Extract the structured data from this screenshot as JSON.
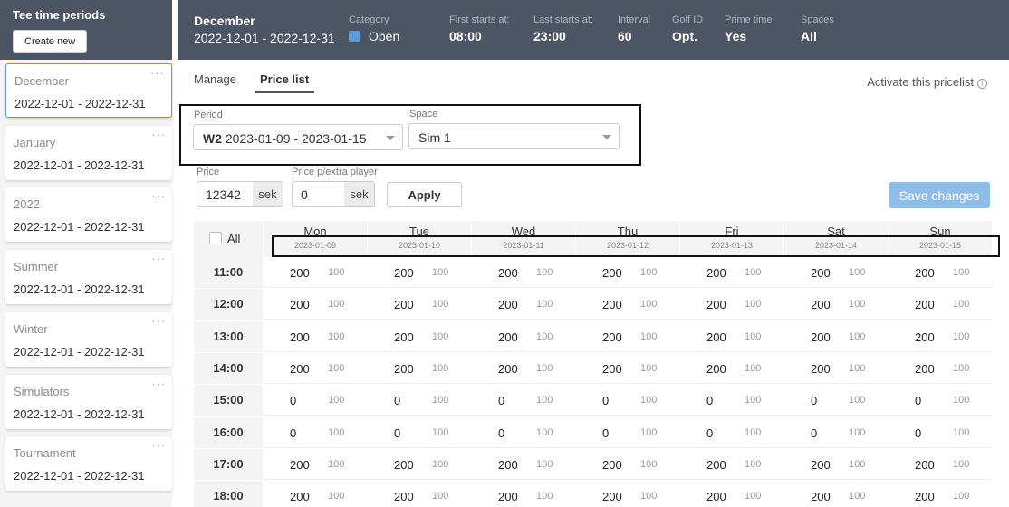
{
  "sidebar": {
    "title": "Tee time periods",
    "create_label": "Create new",
    "items": [
      {
        "name": "December",
        "range": "2022-12-01 - 2022-12-31"
      },
      {
        "name": "January",
        "range": "2022-12-01 - 2022-12-31"
      },
      {
        "name": "2022",
        "range": "2022-12-01 - 2022-12-31"
      },
      {
        "name": "Summer",
        "range": "2022-12-01 - 2022-12-31"
      },
      {
        "name": "Winter",
        "range": "2022-12-01 - 2022-12-31"
      },
      {
        "name": "Simulators",
        "range": "2022-12-01 - 2022-12-31"
      },
      {
        "name": "Tournament",
        "range": "2022-12-01 - 2022-12-31"
      }
    ],
    "more_glyph": "···"
  },
  "header": {
    "period_name": "December",
    "period_range": "2022-12-01 - 2022-12-31",
    "category_label": "Category",
    "category_value": "Open",
    "category_color": "#5b9cd9",
    "first_label": "First starts at:",
    "first_value": "08:00",
    "last_label": "Last starts at:",
    "last_value": "23:00",
    "interval_label": "Interval",
    "interval_value": "60",
    "golfid_label": "Golf ID",
    "golfid_value": "Opt.",
    "prime_label": "Prime time",
    "prime_value": "Yes",
    "spaces_label": "Spaces",
    "spaces_value": "All"
  },
  "tabs": [
    "Manage",
    "Price list"
  ],
  "activate_label": "Activate this pricelist",
  "info_glyph": "i",
  "filters": {
    "period_label": "Period",
    "period_week": "W2",
    "period_value": "2023-01-09 - 2023-01-15",
    "space_label": "Space",
    "space_value": "Sim 1"
  },
  "pricing": {
    "price_label": "Price",
    "price_value": "12342",
    "price_unit": "sek",
    "extra_label": "Price p/extra player",
    "extra_value": "0",
    "extra_unit": "sek",
    "apply_label": "Apply",
    "save_label": "Save changes"
  },
  "grid": {
    "all_label": "All",
    "days": [
      {
        "name": "Mon",
        "date": "2023-01-09"
      },
      {
        "name": "Tue",
        "date": "2023-01-10"
      },
      {
        "name": "Wed",
        "date": "2023-01-11"
      },
      {
        "name": "Thu",
        "date": "2023-01-12"
      },
      {
        "name": "Fri",
        "date": "2023-01-13"
      },
      {
        "name": "Sat",
        "date": "2023-01-14"
      },
      {
        "name": "Sun",
        "date": "2023-01-15"
      }
    ],
    "rows": [
      {
        "time": "11:00",
        "price": "200",
        "extra": "100"
      },
      {
        "time": "12:00",
        "price": "200",
        "extra": "100"
      },
      {
        "time": "13:00",
        "price": "200",
        "extra": "100"
      },
      {
        "time": "14:00",
        "price": "200",
        "extra": "100"
      },
      {
        "time": "15:00",
        "price": "0",
        "extra": "100"
      },
      {
        "time": "16:00",
        "price": "0",
        "extra": "100"
      },
      {
        "time": "17:00",
        "price": "200",
        "extra": "100"
      },
      {
        "time": "18:00",
        "price": "200",
        "extra": "100"
      }
    ]
  }
}
